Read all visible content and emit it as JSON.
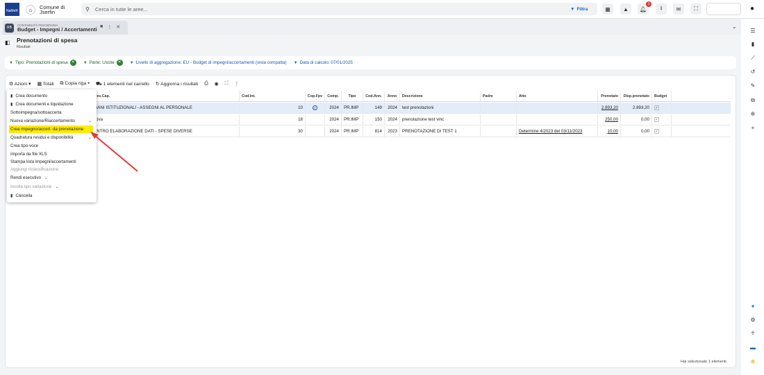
{
  "topbar": {
    "logo_text": "NaMeR",
    "org_line1": "Comune di",
    "org_line2": "Jserfin",
    "search_placeholder": "Cerca in tutte le aree...",
    "filter_label": "Filtra",
    "notification_count": "1"
  },
  "tab": {
    "icon_text": "RB",
    "module": "CONTABILITÀ FINANZIARIA",
    "title": "Budget - Impegni / Accertamenti"
  },
  "page": {
    "title": "Prenotazioni di spesa",
    "subtitle": "Risultati"
  },
  "filters": [
    {
      "label": "Tipo: Prenotazioni di spesa",
      "removable": true,
      "color": "#2e7d32"
    },
    {
      "label": "Parte: Uscite",
      "removable": true,
      "color": "#2e7d32"
    },
    {
      "label": "Livello di aggregazione: EU - Budget di impegni/accertamenti (vista compatta)",
      "removable": false,
      "color": "#1565c0"
    },
    {
      "label": "Data di calcolo: 07/01/2025",
      "removable": false,
      "color": "#1565c0"
    }
  ],
  "toolbar": {
    "actions": "Azioni",
    "totals": "Totali",
    "copy_row": "Copia riga",
    "cart": "1 elementi nel carrello",
    "refresh": "Aggiorna i risultati"
  },
  "grid": {
    "headers": {
      "descap": "ies.Cap.",
      "codint": "Cod.Int.",
      "copfpv": "Cop.Fpv",
      "comp": "Comp.",
      "tipo": "Tipo",
      "codann": "Cod.Ann.",
      "anno": "Anno",
      "descr": "Descrizione",
      "padre": "Padre",
      "atto": "Atto",
      "prenotato": "Prenotato",
      "disp": "Disp.prenotato",
      "budget": "Budget"
    },
    "rows": [
      {
        "descap": "RGANI ISTITUZIONALI - ASSEGNI AL PERSONALE",
        "codint": "10",
        "copfpv": "✓",
        "comp": "2024",
        "tipo": "PR.IMP",
        "codann": "149",
        "anno": "2024",
        "descr": "test prenotazioni",
        "padre": "",
        "atto": "",
        "prenotato": "2.893,20",
        "disp": "2.893,20",
        "budget": "✓"
      },
      {
        "descap": "ova",
        "codint": "18",
        "copfpv": "",
        "comp": "2024",
        "tipo": "PR.IMP",
        "codann": "150",
        "anno": "2024",
        "descr": "prenotazione test vinc",
        "padre": "",
        "atto": "",
        "prenotato": "250,00",
        "disp": "0,00",
        "budget": "✓"
      },
      {
        "descap": "ENTRO ELABORAZIONE DATI - SPESE DIVERSE",
        "codint": "30",
        "copfpv": "",
        "comp": "2024",
        "tipo": "PR.IMP",
        "codann": "814",
        "anno": "2023",
        "descr": "PRENOTAZIONE DI TEST 1",
        "padre": "",
        "atto": "Determine 4/2023 del 03/11/2023",
        "prenotato": "10,00",
        "disp": "0,00",
        "budget": "✓"
      }
    ]
  },
  "menu": {
    "items": [
      {
        "label": "Crea documento",
        "icon": "document-icon",
        "disabled": false
      },
      {
        "label": "Crea documenti e liquidazione",
        "icon": "documents-icon",
        "disabled": false
      },
      {
        "label": "Sottoimpegna/sottoaccerta",
        "disabled": false
      },
      {
        "label": "Nuova variazione/Riaccertamento",
        "disabled": false,
        "submenu": true
      },
      {
        "label": "Crea impegno/accert. da prenotazione",
        "disabled": false,
        "highlighted": true
      },
      {
        "label": "Quadratura residui e disponibilità",
        "disabled": false,
        "submenu": true
      },
      {
        "label": "Crea tipo-voce",
        "disabled": false
      },
      {
        "label": "Importa da file XLS",
        "disabled": false
      },
      {
        "label": "Stampa lista impegni/accertamenti",
        "disabled": false
      },
      {
        "label": "Aggiungi riclassificazione",
        "disabled": true
      },
      {
        "label": "Rendi esecutivo",
        "disabled": false,
        "submenu": true
      },
      {
        "label": "Incolla tipo variazione",
        "disabled": true,
        "submenu": true
      },
      {
        "label": "Cancella",
        "icon": "trash-icon",
        "disabled": false
      }
    ]
  },
  "status": {
    "selection": "Hai selezionato 1 elementi."
  },
  "colors": {
    "highlight": "#ffeb00",
    "annotation_arrow": "#e53935",
    "selected_row": "#e3ecf9"
  }
}
